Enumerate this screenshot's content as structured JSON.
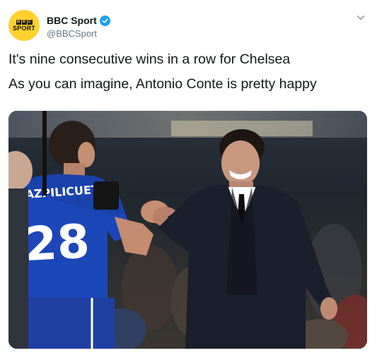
{
  "account": {
    "display_name": "BBC Sport",
    "handle": "@BBCSport",
    "avatar_letters": [
      "B",
      "B",
      "C"
    ],
    "avatar_word": "SPORT",
    "verified": true
  },
  "tweet": {
    "lines": [
      "It's nine consecutive wins in a row for Chelsea",
      "As you can imagine, Antonio Conte is pretty happy"
    ]
  },
  "photo": {
    "shirt_name": "AZPILICUETA",
    "shirt_number": "28"
  },
  "colors": {
    "avatar_bg": "#ffd230",
    "verified": "#1da1f2",
    "handle": "#657786",
    "kit_blue": "#1c47b8"
  },
  "icons": {
    "verified": "verified-badge-icon",
    "menu": "chevron-down-icon"
  }
}
